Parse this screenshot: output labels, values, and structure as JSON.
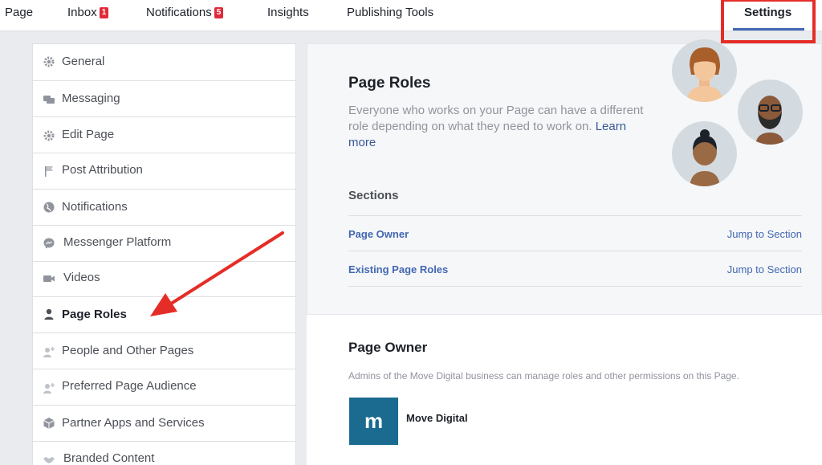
{
  "nav": {
    "page": "Page",
    "inbox": "Inbox",
    "inbox_count": "1",
    "notifications": "Notifications",
    "notifications_count": "5",
    "insights": "Insights",
    "publishing_tools": "Publishing Tools",
    "settings": "Settings"
  },
  "sidebar": {
    "items": [
      {
        "label": "General",
        "icon": "gear-icon"
      },
      {
        "label": "Messaging",
        "icon": "messaging-icon"
      },
      {
        "label": "Edit Page",
        "icon": "gear-icon"
      },
      {
        "label": "Post Attribution",
        "icon": "flag-icon"
      },
      {
        "label": "Notifications",
        "icon": "globe-icon"
      },
      {
        "label": "Messenger Platform",
        "icon": "messenger-icon"
      },
      {
        "label": "Videos",
        "icon": "video-camera-icon"
      },
      {
        "label": "Page Roles",
        "icon": "person-icon"
      },
      {
        "label": "People and Other Pages",
        "icon": "person-add-icon"
      },
      {
        "label": "Preferred Page Audience",
        "icon": "person-add-icon"
      },
      {
        "label": "Partner Apps and Services",
        "icon": "cube-icon"
      },
      {
        "label": "Branded Content",
        "icon": "handshake-icon"
      }
    ]
  },
  "page_roles": {
    "title": "Page Roles",
    "description": "Everyone who works on your Page can have a different role depending on what they need to work on.",
    "learn_more": "Learn more",
    "sections_title": "Sections",
    "sections": [
      {
        "label": "Page Owner",
        "action": "Jump to Section"
      },
      {
        "label": "Existing Page Roles",
        "action": "Jump to Section"
      }
    ]
  },
  "page_owner": {
    "title": "Page Owner",
    "description": "Admins of the Move Digital business can manage roles and other permissions on this Page.",
    "logo_letter": "m",
    "business_name": "Move Digital"
  },
  "colors": {
    "accent": "#4267b2",
    "highlight_box": "#e52d27",
    "badge": "#e0293a",
    "logo_bg": "#1a6b8f"
  }
}
